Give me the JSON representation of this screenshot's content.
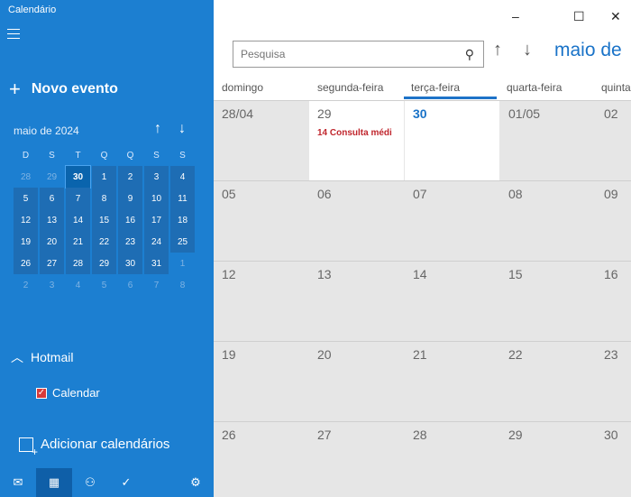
{
  "app_title": "Calendário",
  "new_event_label": "Novo evento",
  "mini_calendar": {
    "month": "maio de 2024",
    "days_of_week": [
      "D",
      "S",
      "T",
      "Q",
      "Q",
      "S",
      "S"
    ],
    "weeks": [
      [
        "28",
        "29",
        "30",
        "1",
        "2",
        "3",
        "4"
      ],
      [
        "5",
        "6",
        "7",
        "8",
        "9",
        "10",
        "11"
      ],
      [
        "12",
        "13",
        "14",
        "15",
        "16",
        "17",
        "18"
      ],
      [
        "19",
        "20",
        "21",
        "22",
        "23",
        "24",
        "25"
      ],
      [
        "26",
        "27",
        "28",
        "29",
        "30",
        "31",
        "1"
      ],
      [
        "2",
        "3",
        "4",
        "5",
        "6",
        "7",
        "8"
      ]
    ]
  },
  "account": {
    "name": "Hotmail",
    "calendar": "Calendar"
  },
  "add_calendars_label": "Adicionar calendários",
  "search": {
    "placeholder": "Pesquisa"
  },
  "header": {
    "month_title": "maio de"
  },
  "window_buttons": {
    "minimize": "–",
    "maximize": "☐",
    "close": "✕"
  },
  "days_header": [
    "domingo",
    "segunda-feira",
    "terça-feira",
    "quarta-feira",
    "quinta"
  ],
  "weeks": [
    {
      "days": [
        "28/04",
        "29",
        "30",
        "01/05",
        "02"
      ],
      "event": "14 Consulta médi"
    },
    {
      "days": [
        "05",
        "06",
        "07",
        "08",
        "09"
      ]
    },
    {
      "days": [
        "12",
        "13",
        "14",
        "15",
        "16"
      ]
    },
    {
      "days": [
        "19",
        "20",
        "21",
        "22",
        "23"
      ]
    },
    {
      "days": [
        "26",
        "27",
        "28",
        "29",
        "30"
      ]
    }
  ],
  "colors": {
    "sidebar": "#1c7fd1",
    "accent": "#1a73c8",
    "event": "#c0262d"
  }
}
